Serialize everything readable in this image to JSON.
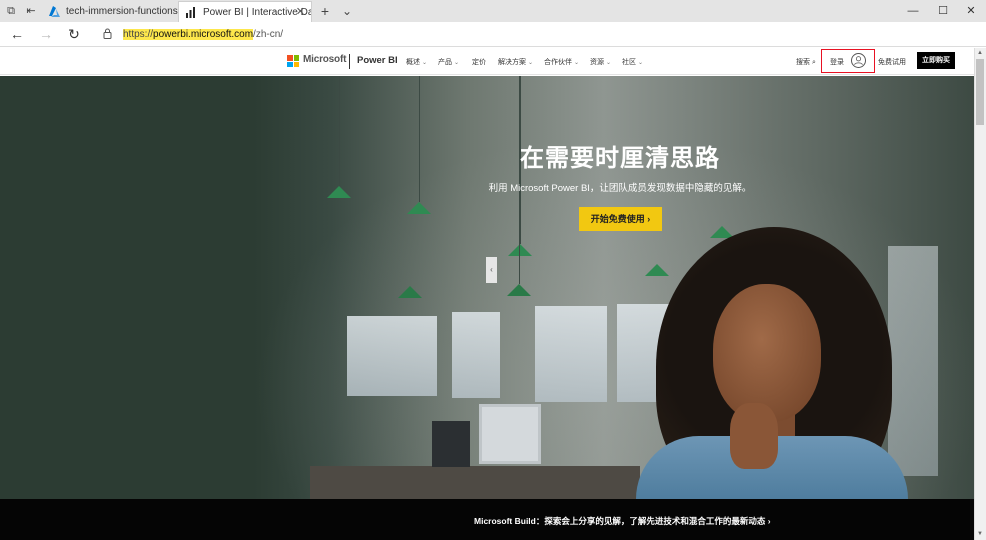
{
  "browser": {
    "tabs": [
      {
        "title": "tech-immersion-functions -",
        "icon": "azure-icon",
        "active": false
      },
      {
        "title": "Power BI | Interactive Da",
        "icon": "powerbi-bars-icon",
        "active": true
      }
    ],
    "new_tab": "+",
    "tab_list": "⌄",
    "window_controls": {
      "minimize": "—",
      "maximize": "☐",
      "close": "✕"
    },
    "address": {
      "prefix": "https://",
      "host": "powerbi.microsoft.com",
      "path": "/zh-cn/"
    }
  },
  "site_nav": {
    "brand": "Microsoft",
    "product": "Power BI",
    "items": [
      {
        "label": "概述",
        "has_menu": true
      },
      {
        "label": "产品",
        "has_menu": true
      },
      {
        "label": "定价",
        "has_menu": false
      },
      {
        "label": "解决方案",
        "has_menu": true
      },
      {
        "label": "合作伙伴",
        "has_menu": true
      },
      {
        "label": "资源",
        "has_menu": true
      },
      {
        "label": "社区",
        "has_menu": true
      }
    ],
    "search_label": "搜索",
    "signin_label": "登录",
    "free_trial_label": "免费试用",
    "buy_label": "立即购买",
    "colors": {
      "ms_red": "#f25022",
      "ms_green": "#7fba00",
      "ms_blue": "#00a4ef",
      "ms_yellow": "#ffb900",
      "highlight_box": "#e81123"
    }
  },
  "hero": {
    "title": "在需要时厘清思路",
    "subtitle": "利用 Microsoft Power BI，让团队成员发现数据中隐藏的见解。",
    "cta_label": "开始免费使用",
    "cta_color": "#f2c811"
  },
  "banner": {
    "text": "Microsoft Build：探索会上分享的见解，了解先进技术和混合工作的最新动态"
  }
}
